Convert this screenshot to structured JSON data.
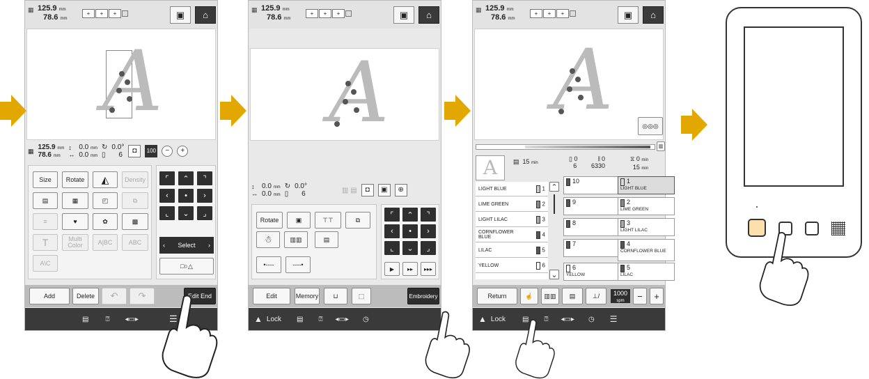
{
  "header": {
    "size_w": "125.9",
    "size_h": "78.6",
    "unit": "mm"
  },
  "panel1": {
    "info": {
      "w": "125.9",
      "h": "78.6",
      "unit": "mm",
      "pos_x": "0.0",
      "pos_y": "0.0",
      "angle": "0.0°",
      "thread_count": "6",
      "zoom": "100"
    },
    "buttons": {
      "size": "Size",
      "rotate": "Rotate",
      "density": "Density",
      "multi_color": "Multi\nColor",
      "abc1": "A|BC",
      "abc2": "ABC",
      "select": "Select"
    },
    "actions": {
      "add": "Add",
      "delete": "Delete",
      "edit_end": "Edit End"
    }
  },
  "panel2": {
    "info": {
      "pos_x": "0.0",
      "pos_y": "0.0",
      "unit": "mm",
      "angle": "0.0°",
      "thread_count": "6"
    },
    "buttons": {
      "rotate": "Rotate"
    },
    "actions": {
      "edit": "Edit",
      "memory": "Memory",
      "embroidery": "Embroidery",
      "lock": "Lock"
    }
  },
  "panel3": {
    "time": "15",
    "time_unit": "min",
    "stitch_done": "0",
    "stitch_total": "6",
    "stitch_count": "0",
    "stitch_count_total": "6330",
    "time_done": "0",
    "time_total": "15",
    "threads": [
      {
        "name": "LIGHT BLUE",
        "num": "1"
      },
      {
        "name": "LIME GREEN",
        "num": "2"
      },
      {
        "name": "LIGHT LILAC",
        "num": "3"
      },
      {
        "name": "CORNFLOWER BLUE",
        "num": "4"
      },
      {
        "name": "LILAC",
        "num": "5"
      },
      {
        "name": "YELLOW",
        "num": "6"
      }
    ],
    "grid_left": [
      {
        "num": "10",
        "name": ""
      },
      {
        "num": "9",
        "name": ""
      },
      {
        "num": "8",
        "name": ""
      },
      {
        "num": "7",
        "name": ""
      },
      {
        "num": "6",
        "name": "YELLOW"
      }
    ],
    "grid_right": [
      {
        "num": "1",
        "name": "LIGHT BLUE"
      },
      {
        "num": "2",
        "name": "LIME GREEN"
      },
      {
        "num": "3",
        "name": "LIGHT LILAC"
      },
      {
        "num": "4",
        "name": "CORNFLOWER BLUE"
      },
      {
        "num": "5",
        "name": "LILAC"
      }
    ],
    "actions": {
      "return": "Return",
      "speed": "1000",
      "speed_unit": "spm",
      "lock": "Lock"
    }
  },
  "colors": {
    "arrow": "#e3a800",
    "highlight_button": "#fbe0ad"
  }
}
